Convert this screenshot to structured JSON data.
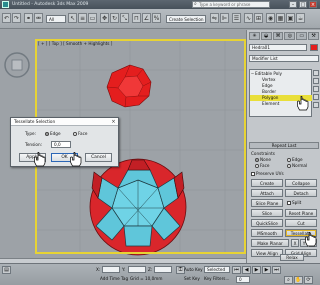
{
  "title_bar": {
    "title": "Untitled - Autodesk 3ds Max 2009",
    "search_placeholder": "Type a keyword or phrase"
  },
  "toolbar": {
    "selection_filter": "All",
    "selection_set": "Create Selection Se"
  },
  "viewport": {
    "label": "[ + ] [ Top ] [ Smooth + Highlights ]"
  },
  "command_panel": {
    "object_name": "Hedra01",
    "modifier_list": "Modifier List",
    "stack": [
      {
        "label": "Editable Poly",
        "expander": "−"
      },
      {
        "label": "Vertex"
      },
      {
        "label": "Edge"
      },
      {
        "label": "Border"
      },
      {
        "label": "Polygon"
      },
      {
        "label": "Element"
      }
    ],
    "rollout_repeat": "Repeat Last",
    "constraints_label": "Constraints",
    "constraints": {
      "none": "None",
      "edge": "Edge",
      "face": "Face",
      "normal": "Normal"
    },
    "preserve_uvs": "Preserve UVs",
    "buttons": {
      "create": "Create",
      "collapse": "Collapse",
      "attach": "Attach",
      "detach": "Detach",
      "slice_plane": "Slice Plane",
      "split": "Split",
      "slice": "Slice",
      "reset_plane": "Reset Plane",
      "quickslice": "QuickSlice",
      "cut": "Cut",
      "msmooth": "MSmooth",
      "tessellate": "Tessellate",
      "make_planar": "Make Planar",
      "view_align": "View Align",
      "grid_align": "Grid Align",
      "relax": "Relax"
    },
    "mini_axes": {
      "x": "X",
      "y": "Y",
      "z": "Z"
    }
  },
  "dialog": {
    "title": "Tessellate Selection",
    "type_label": "Type:",
    "type_edge": "Edge",
    "type_face": "Face",
    "tension_label": "Tension:",
    "tension_value": "0,0",
    "apply": "Apply",
    "ok": "OK",
    "cancel": "Cancel"
  },
  "bottom_bar": {
    "x_label": "X:",
    "y_label": "Y:",
    "z_label": "Z:",
    "grid": "Grid = 10,0mm",
    "auto_key": "Auto Key",
    "set_key": "Set Key",
    "key_filters": "Key Filters...",
    "selected": "Selected",
    "add_time_tag": "Add Time Tag",
    "frame": "0"
  },
  "colors": {
    "viewport_border": "#e7d334",
    "object_red": "#e41e1e",
    "polygon_selection": "#e9df3a",
    "selected_faces": "#6fd3e6"
  }
}
